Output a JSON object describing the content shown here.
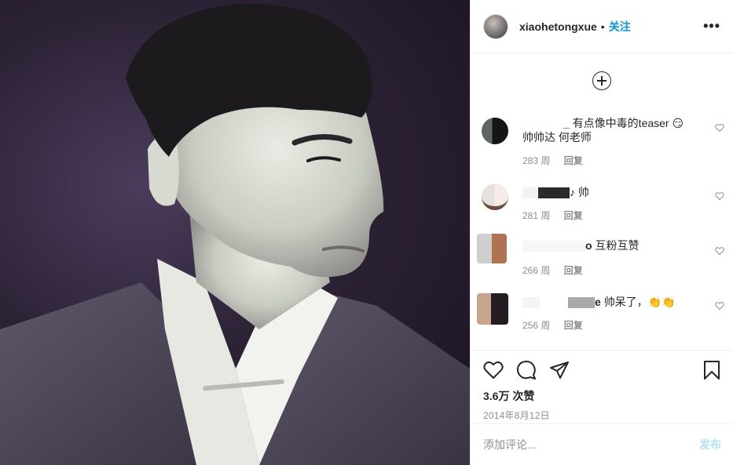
{
  "post": {
    "username": "xiaohetongxue",
    "separator": "•",
    "follow_label": "关注",
    "more_label": "•••",
    "likes": "3.6万 次赞",
    "date": "2014年8月12日"
  },
  "comments": [
    {
      "name_fragment": "_",
      "text": "有点像中毒的teaser 😏",
      "text2": "帅帅达 何老师",
      "age": "283 周",
      "reply": "回复"
    },
    {
      "name_fragment": "♪",
      "text": "帅",
      "age": "281 周",
      "reply": "回复"
    },
    {
      "name_fragment": "o",
      "text": "互粉互赞",
      "age": "266 周",
      "reply": "回复"
    },
    {
      "name_fragment": "e",
      "text": "帅呆了，👏👏",
      "age": "256 周",
      "reply": "回复"
    }
  ],
  "add_comment": {
    "placeholder": "添加评论...",
    "post_label": "发布"
  },
  "icons": {
    "like": "heart-icon",
    "comment": "comment-icon",
    "share": "paper-plane-icon",
    "save": "bookmark-icon",
    "load_more": "plus-circle-icon"
  }
}
